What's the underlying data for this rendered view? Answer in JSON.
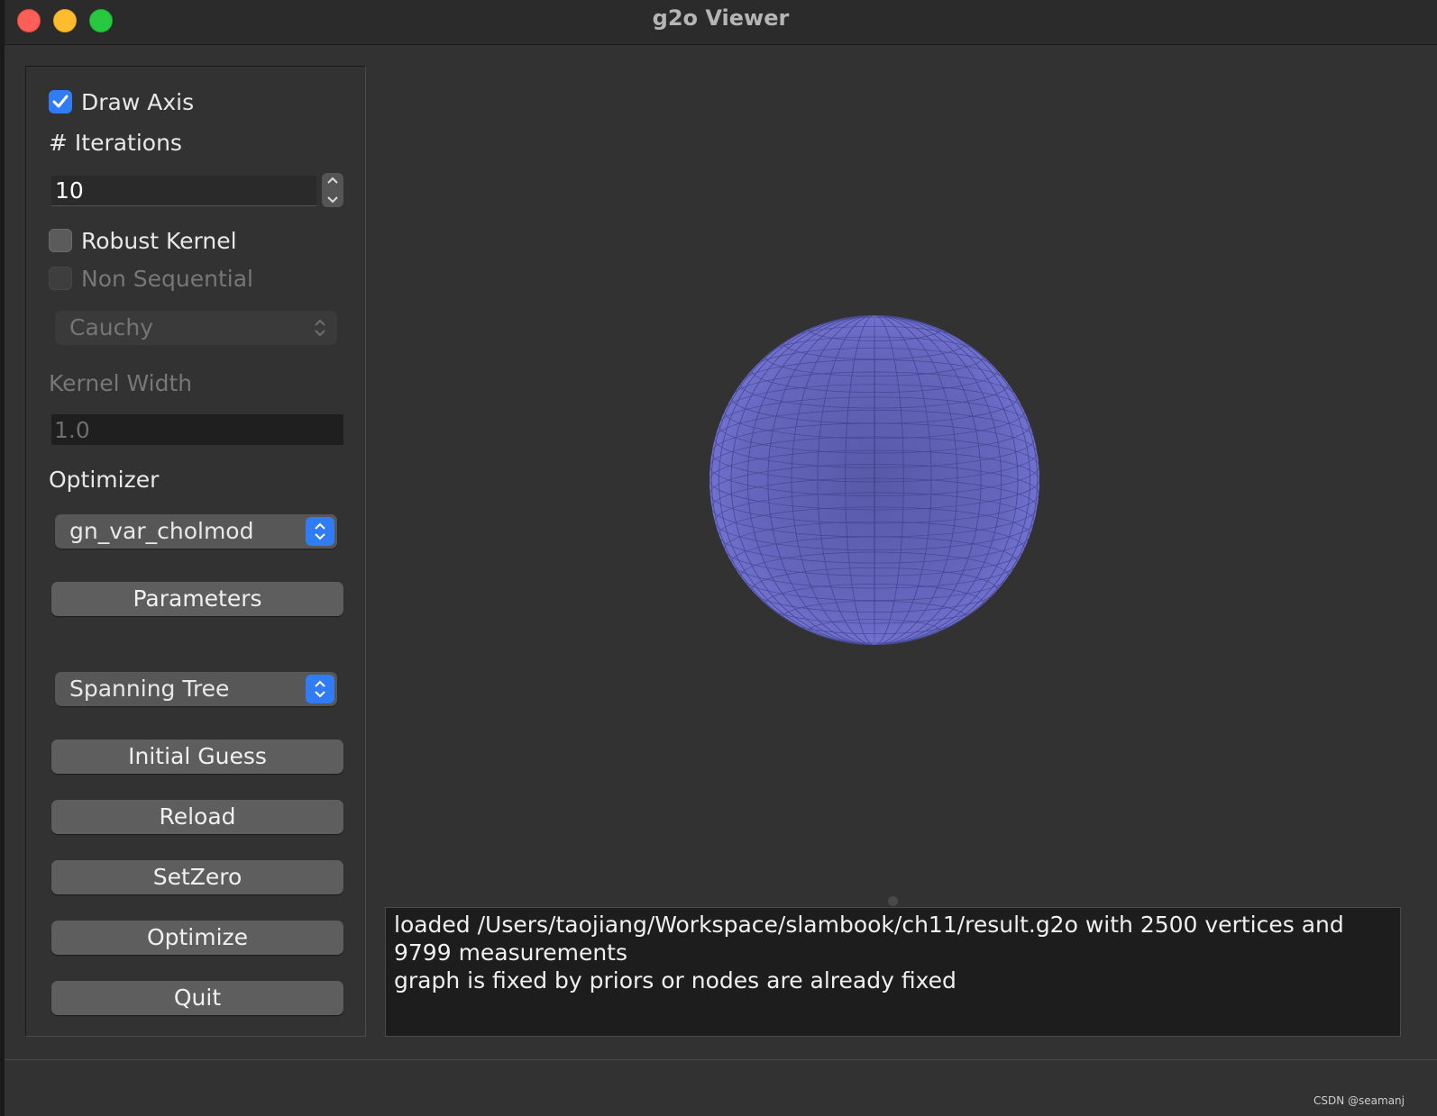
{
  "window": {
    "title": "g2o Viewer"
  },
  "controls": {
    "draw_axis": {
      "label": "Draw Axis",
      "checked": true
    },
    "iterations": {
      "label": "# Iterations",
      "value": "10"
    },
    "robust_kernel": {
      "label": "Robust Kernel",
      "checked": false
    },
    "non_sequential": {
      "label": "Non Sequential",
      "checked": false,
      "enabled": false
    },
    "kernel_select": {
      "value": "Cauchy",
      "enabled": false
    },
    "kernel_width": {
      "label": "Kernel Width",
      "value": "1.0",
      "enabled": false
    },
    "optimizer": {
      "label": "Optimizer",
      "value": "gn_var_cholmod"
    },
    "parameters_label": "Parameters",
    "initial_guess_select": {
      "value": "Spanning Tree"
    },
    "initial_guess_label": "Initial Guess",
    "reload_label": "Reload",
    "setzero_label": "SetZero",
    "optimize_label": "Optimize",
    "quit_label": "Quit"
  },
  "log": {
    "lines": [
      "loaded /Users/taojiang/Workspace/slambook/ch11/result.g2o with 2500 vertices and 9799 measurements",
      "graph is fixed by priors or nodes are already fixed"
    ]
  },
  "watermark": "CSDN @seamanj",
  "colors": {
    "sphere": "#6a6bc2",
    "accent": "#2f7cf6"
  }
}
